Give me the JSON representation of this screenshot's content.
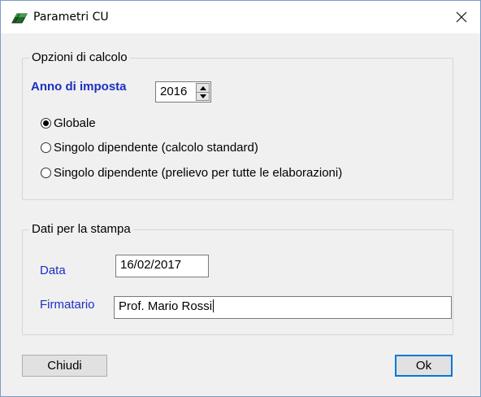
{
  "window": {
    "title": "Parametri CU",
    "close_glyph": "✕",
    "title_icon": "green-eraser-icon"
  },
  "calc_options": {
    "legend": "Opzioni di calcolo",
    "anno_label": "Anno di imposta",
    "anno_value": "2016",
    "radios": [
      {
        "label": "Globale",
        "checked": true
      },
      {
        "label": "Singolo dipendente (calcolo standard)",
        "checked": false
      },
      {
        "label": "Singolo dipendente (prelievo per tutte le elaborazioni)",
        "checked": false
      }
    ]
  },
  "print_data": {
    "legend": "Dati per la stampa",
    "data_label": "Data",
    "data_value": "16/02/2017",
    "firmatario_label": "Firmatario",
    "firmatario_value": "Prof. Mario Rossi"
  },
  "buttons": {
    "close_label": "Chiudi",
    "ok_label": "Ok"
  },
  "colors": {
    "label_blue": "#1d2fc2",
    "default_button_border": "#0078d7",
    "dialog_bg": "#f0f0f0"
  }
}
